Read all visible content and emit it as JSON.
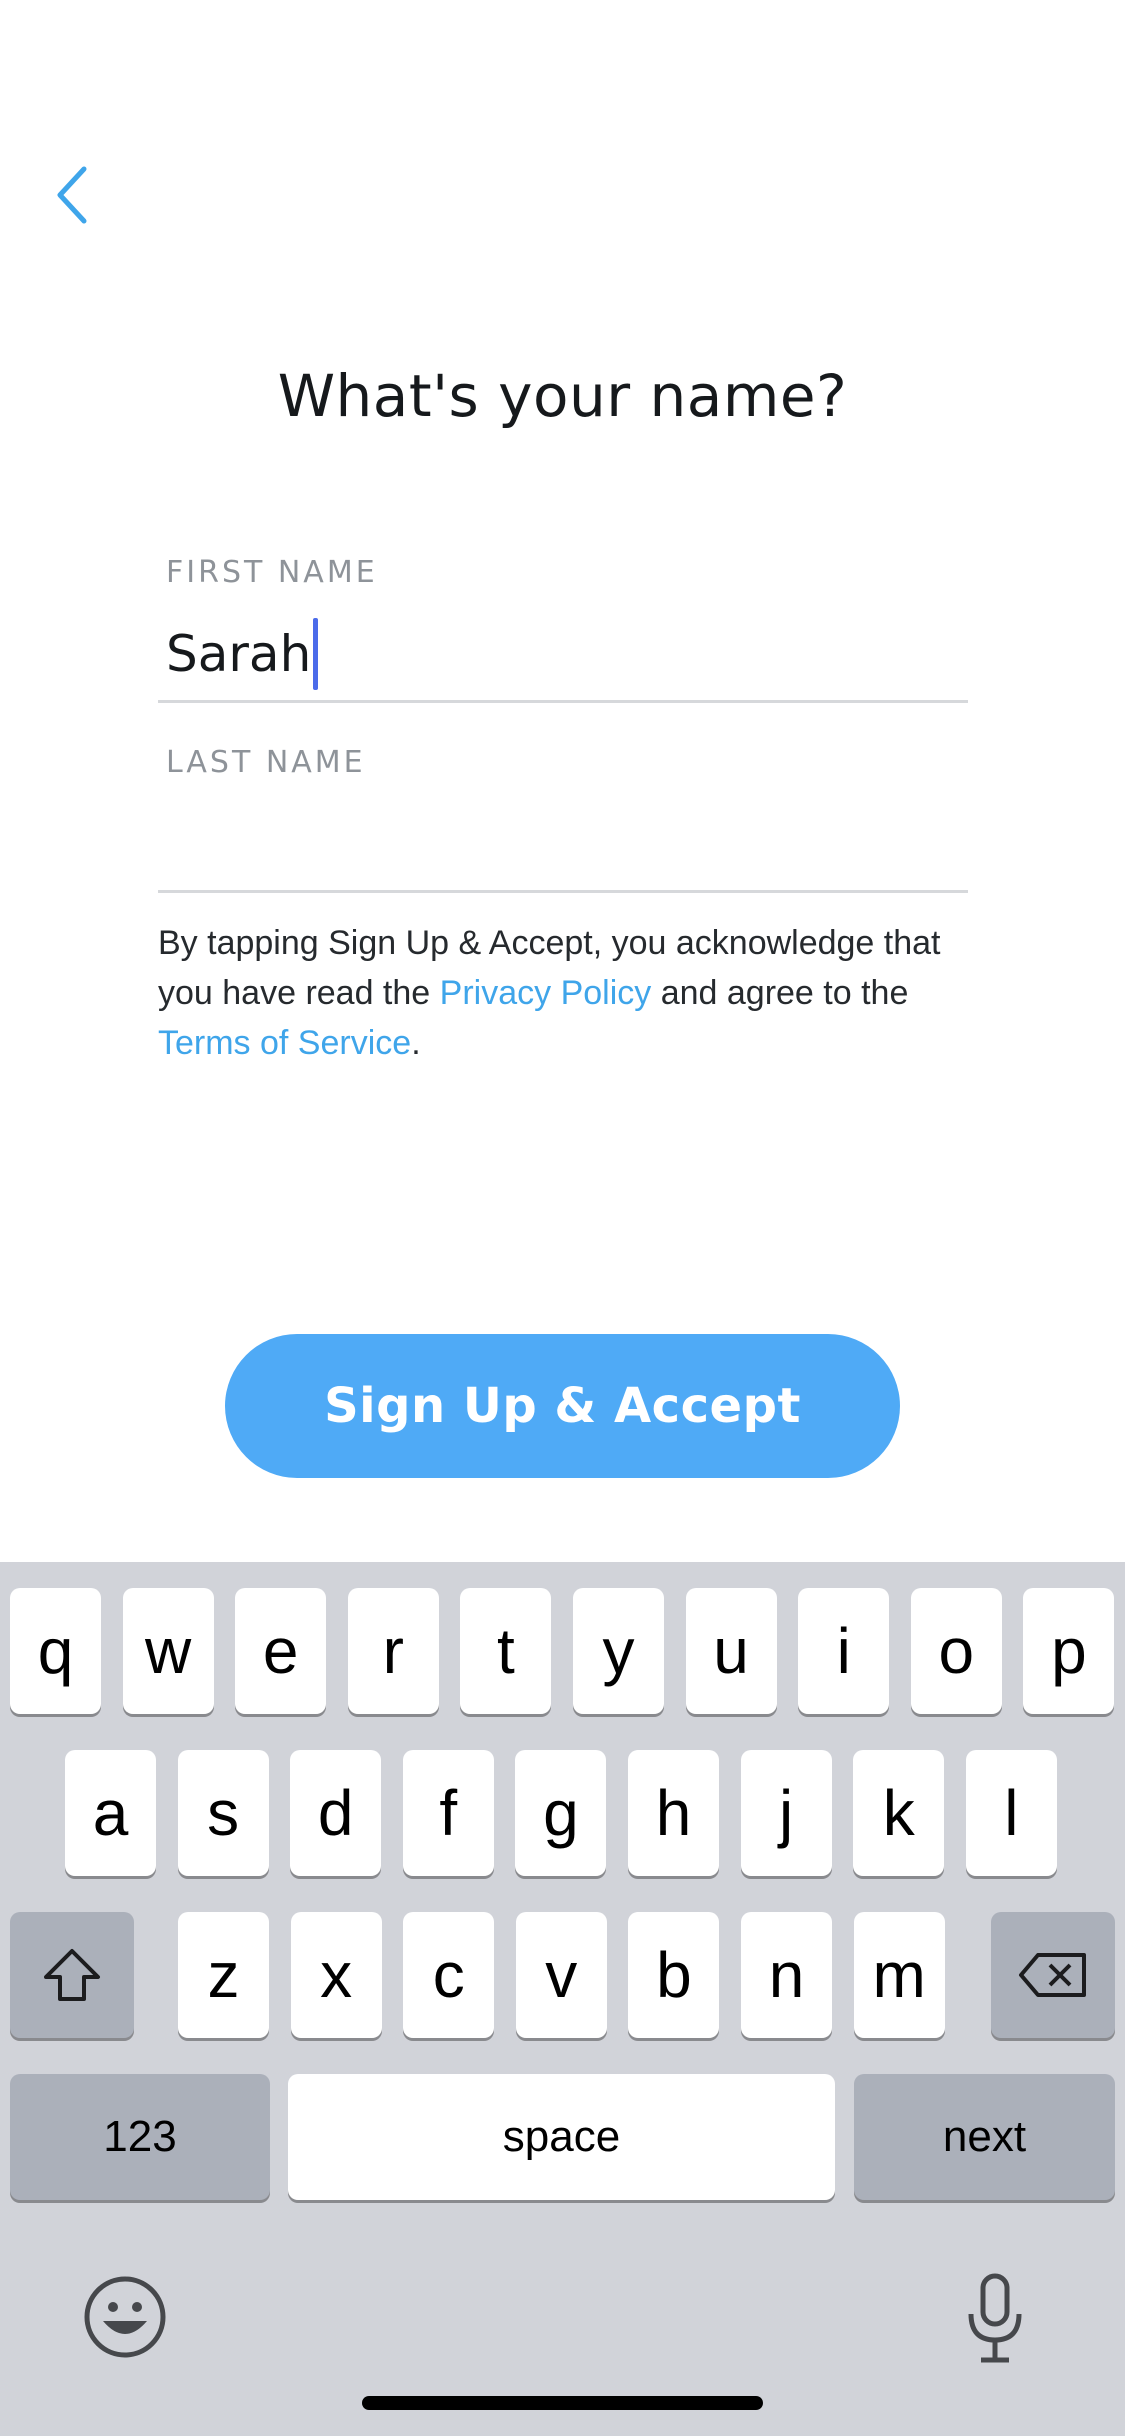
{
  "nav": {
    "back_icon": "chevron-left-icon"
  },
  "title": "What's your name?",
  "form": {
    "first_name": {
      "label": "FIRST NAME",
      "value": "Sarah"
    },
    "last_name": {
      "label": "LAST NAME",
      "value": ""
    }
  },
  "legal": {
    "prefix": "By tapping Sign Up & Accept, you acknowledge that you have read the ",
    "privacy_link": "Privacy Policy",
    "middle": " and agree to the ",
    "terms_link": "Terms of Service",
    "suffix": "."
  },
  "cta": {
    "label": "Sign Up & Accept"
  },
  "colors": {
    "accent": "#4faaf6",
    "link": "#3fa5ea",
    "caret": "#4b6bea"
  },
  "keyboard": {
    "row1": [
      "q",
      "w",
      "e",
      "r",
      "t",
      "y",
      "u",
      "i",
      "o",
      "p"
    ],
    "row2": [
      "a",
      "s",
      "d",
      "f",
      "g",
      "h",
      "j",
      "k",
      "l"
    ],
    "row3": [
      "z",
      "x",
      "c",
      "v",
      "b",
      "n",
      "m"
    ],
    "numbers_label": "123",
    "space_label": "space",
    "return_label": "next",
    "icons": {
      "shift": "shift-icon",
      "delete": "backspace-icon",
      "emoji": "emoji-icon",
      "dictation": "microphone-icon"
    }
  }
}
